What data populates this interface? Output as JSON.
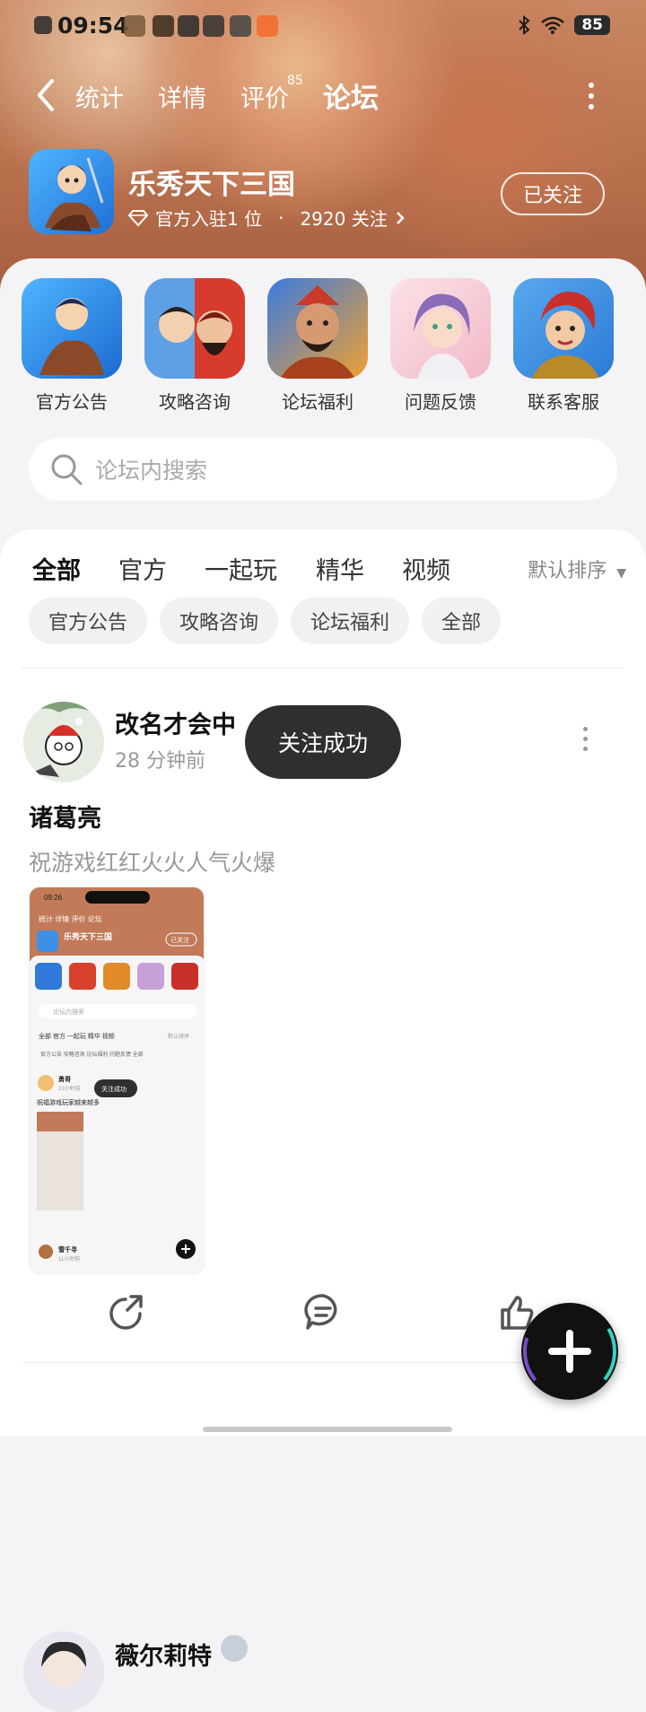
{
  "status_bar": {
    "time": "09:54",
    "battery": "85"
  },
  "nav": {
    "tabs": [
      {
        "label": "统计"
      },
      {
        "label": "详情"
      },
      {
        "label": "评价",
        "badge": "85"
      },
      {
        "label": "论坛",
        "active": true
      }
    ]
  },
  "app": {
    "name": "乐秀天下三国",
    "official": "官方入驻1 位",
    "separator": "·",
    "followers": "2920 关注",
    "follow_button": "已关注"
  },
  "categories": [
    {
      "label": "官方公告"
    },
    {
      "label": "攻略咨询"
    },
    {
      "label": "论坛福利"
    },
    {
      "label": "问题反馈"
    },
    {
      "label": "联系客服"
    }
  ],
  "search": {
    "placeholder": "论坛内搜索"
  },
  "feed_tabs": [
    {
      "label": "全部",
      "active": true
    },
    {
      "label": "官方"
    },
    {
      "label": "一起玩"
    },
    {
      "label": "精华"
    },
    {
      "label": "视频"
    }
  ],
  "sort": {
    "label": "默认排序"
  },
  "chips": [
    "官方公告",
    "攻略咨询",
    "论坛福利",
    "全部"
  ],
  "post": {
    "author": "改名才会中",
    "time": "28 分钟前",
    "title": "诸葛亮",
    "body": "祝游戏红红火火人气火爆"
  },
  "thumb": {
    "time": "09:26",
    "tabs": "统计  详情  评价  论坛",
    "app_name": "乐秀天下三国",
    "follow": "已关注",
    "search": "论坛内搜索",
    "feed_tabs": "全部  官方  一起玩  精华  视频",
    "sort": "默认排序",
    "chips": "官方公告  攻略咨询  论坛福利  问题反馈  全部",
    "author": "勇哥",
    "time_ago": "21小时前",
    "toast": "关注成功",
    "body": "祝福游戏玩家越来越多",
    "author2": "雪千寻",
    "time2": "11小时前"
  },
  "post2": {
    "author": "薇尔莉特"
  },
  "toast": "关注成功",
  "colors": {
    "accent": "#35d1c0",
    "header_bg": "#b9714d",
    "toast_bg": "#2f2f2f"
  }
}
